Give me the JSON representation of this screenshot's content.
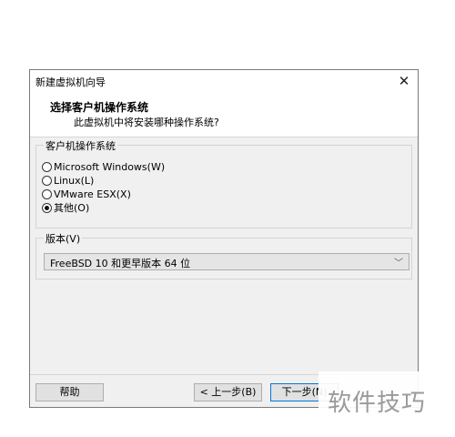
{
  "window": {
    "title": "新建虚拟机向导",
    "close_glyph": "✕"
  },
  "header": {
    "title": "选择客户机操作系统",
    "subtitle": "此虚拟机中将安装哪种操作系统?"
  },
  "guest_os": {
    "label": "客户机操作系统",
    "options": [
      {
        "label": "Microsoft Windows(W)",
        "checked": false
      },
      {
        "label": "Linux(L)",
        "checked": false
      },
      {
        "label": "VMware ESX(X)",
        "checked": false
      },
      {
        "label": "其他(O)",
        "checked": true
      }
    ]
  },
  "version": {
    "label": "版本(V)",
    "selected": "FreeBSD 10 和更早版本 64 位",
    "chevron": "﹀"
  },
  "buttons": {
    "help": "帮助",
    "back": "< 上一步(B)",
    "next": "下一步(N)"
  },
  "watermark": {
    "text": "软件技巧"
  }
}
